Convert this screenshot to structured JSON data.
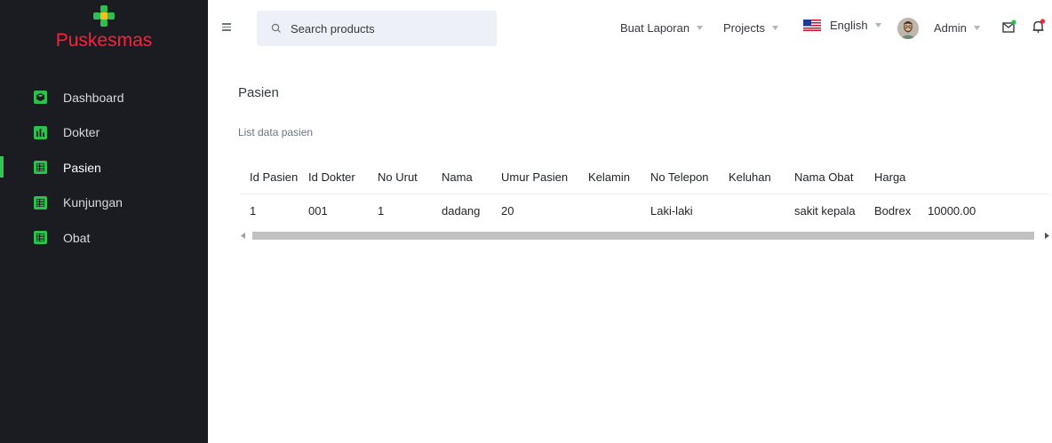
{
  "brand": {
    "name": "Puskesmas"
  },
  "sidebar": {
    "items": [
      {
        "label": "Dashboard",
        "icon": "cube-icon"
      },
      {
        "label": "Dokter",
        "icon": "bar-chart-icon"
      },
      {
        "label": "Pasien",
        "icon": "table-icon",
        "active": true
      },
      {
        "label": "Kunjungan",
        "icon": "table-icon"
      },
      {
        "label": "Obat",
        "icon": "table-icon"
      }
    ]
  },
  "header": {
    "search_placeholder": "Search products",
    "report_label": "Buat Laporan",
    "projects_label": "Projects",
    "language_label": "English",
    "user_label": "Admin"
  },
  "page": {
    "title": "Pasien",
    "subtitle": "List data pasien"
  },
  "table": {
    "columns": [
      "Id Pasien",
      "Id Dokter",
      "No Urut",
      "Nama",
      "Umur Pasien",
      "Kelamin",
      "No Telepon",
      "Keluhan",
      "Nama Obat",
      "Harga"
    ],
    "rows": [
      [
        "1",
        "001",
        "1",
        "dadang",
        "20",
        "",
        "Laki-laki",
        "",
        "sakit kepala",
        "Bodrex",
        "10000.00"
      ]
    ]
  },
  "colors": {
    "sidebar_bg": "#1b1c22",
    "brand_red": "#ff1f3b",
    "accent_green": "#2fbf4f",
    "search_bg": "#eef0f7"
  }
}
